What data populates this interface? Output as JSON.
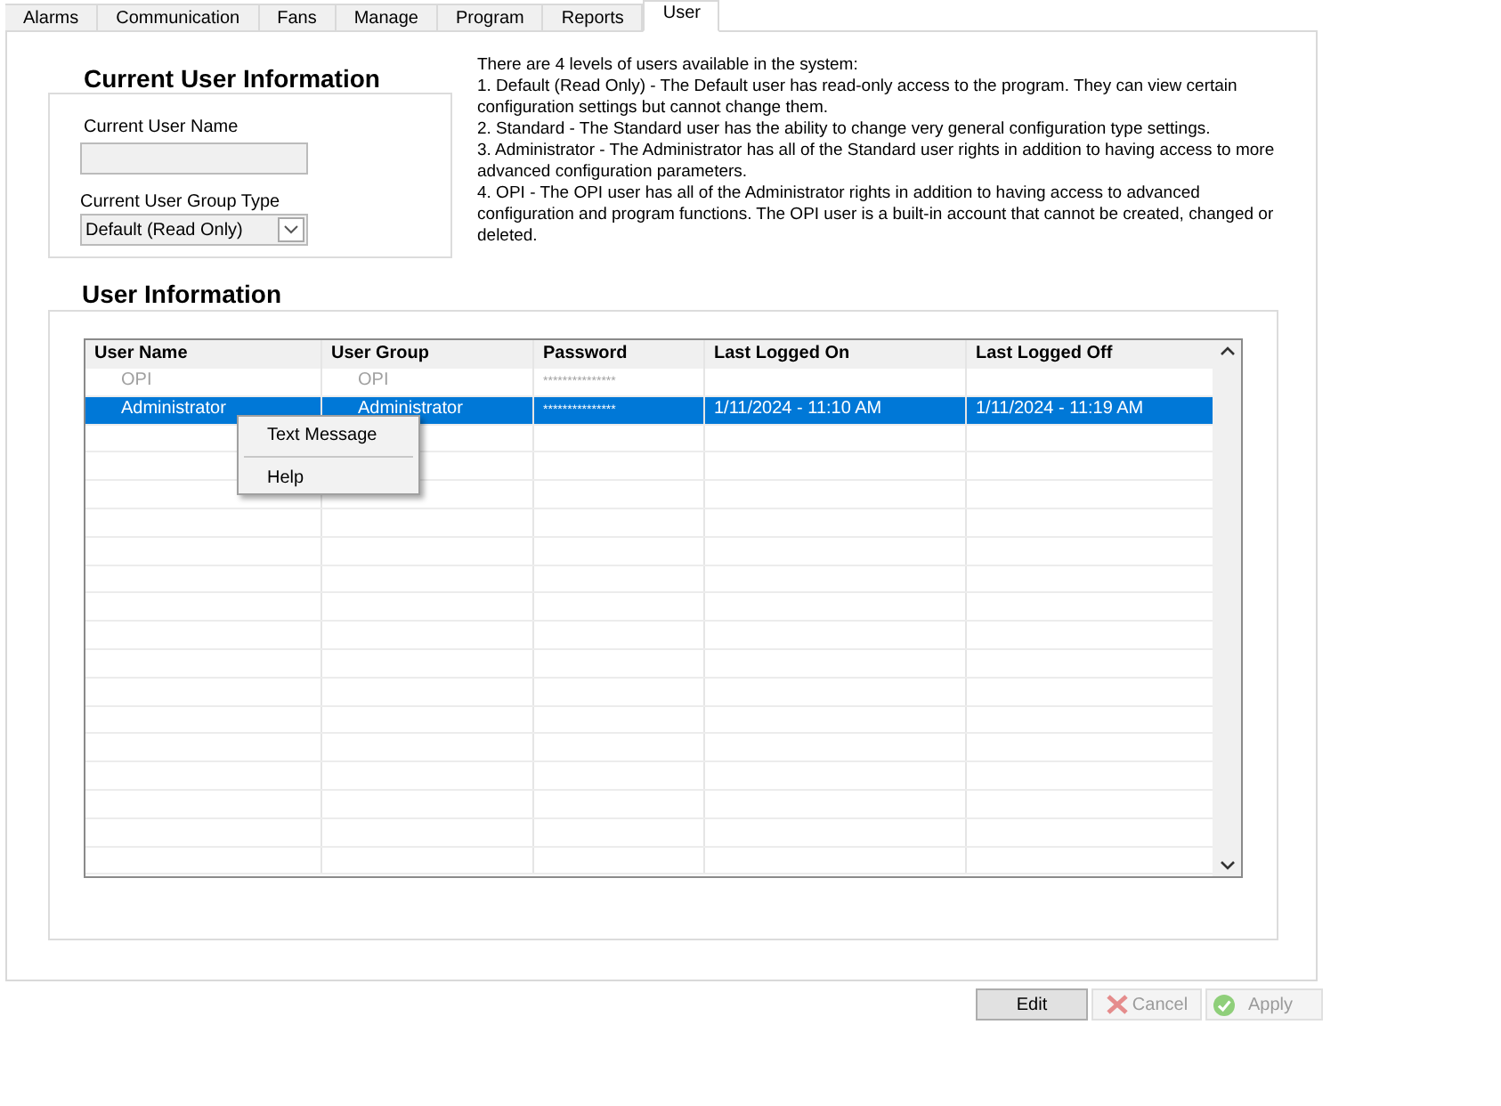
{
  "tabs": [
    {
      "label": "Alarms",
      "selected": false
    },
    {
      "label": "Communication",
      "selected": false
    },
    {
      "label": "Fans",
      "selected": false
    },
    {
      "label": "Manage",
      "selected": false
    },
    {
      "label": "Program",
      "selected": false
    },
    {
      "label": "Reports",
      "selected": false
    },
    {
      "label": "User",
      "selected": true
    }
  ],
  "current_user": {
    "title": "Current User Information",
    "name_label": "Current User Name",
    "group_label": "Current User Group Type",
    "group_value": "Default (Read Only)"
  },
  "description": [
    "There are 4 levels of users available in the system:",
    "1.  Default (Read Only) - The Default user has read-only access to the program.  They can view certain configuration settings but cannot change them.",
    "2.  Standard - The Standard user has the ability to change very general configuration type settings.",
    "3.  Administrator - The Administrator has all of the Standard user rights in addition to having access to more advanced configuration parameters.",
    "4.  OPI - The OPI user has all of the Administrator rights in addition to having access to advanced configuration and program functions.  The OPI user is a built-in account that cannot be created, changed or deleted."
  ],
  "user_info": {
    "title": "User Information",
    "table": {
      "columns": [
        "User Name",
        "User Group",
        "Password",
        "Last Logged On",
        "Last Logged Off"
      ],
      "rows": [
        {
          "cells": [
            "OPI",
            "OPI",
            "***************",
            "",
            ""
          ],
          "selected": false,
          "disabled": true
        },
        {
          "cells": [
            "Administrator",
            "Administrator",
            "***************",
            "1/11/2024 - 11:10 AM",
            "1/11/2024 - 11:19 AM"
          ],
          "selected": true,
          "disabled": false
        }
      ]
    }
  },
  "context_menu": [
    {
      "label": "Text Message"
    },
    {
      "label": "Help"
    }
  ],
  "buttons": [
    {
      "label": "Edit",
      "kind": "plain",
      "disabled": false
    },
    {
      "label": "Cancel",
      "kind": "cancel",
      "disabled": true
    },
    {
      "label": "Apply",
      "kind": "apply",
      "disabled": true
    }
  ]
}
